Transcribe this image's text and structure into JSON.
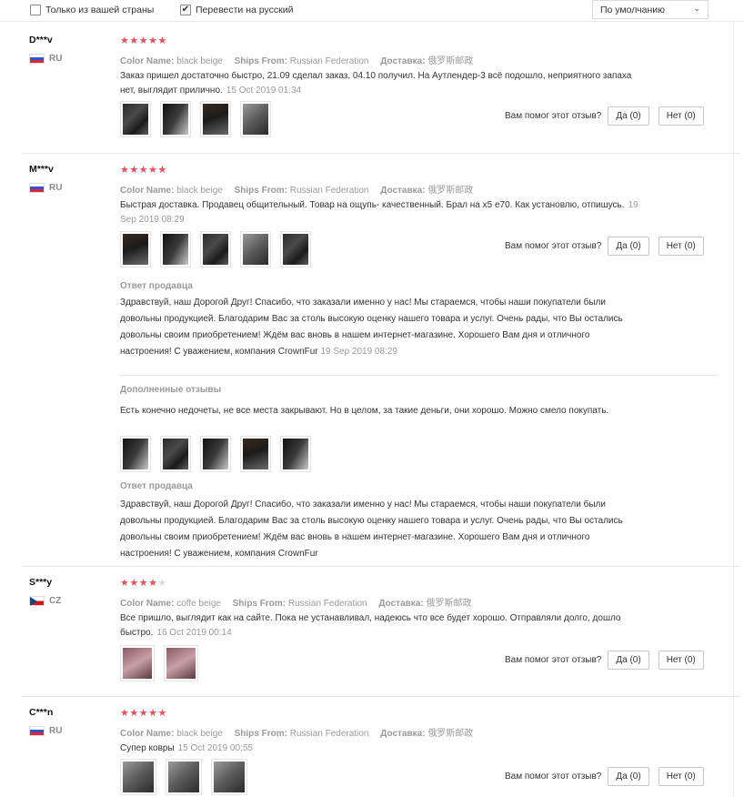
{
  "filters": {
    "only_country": {
      "label": "Только из вашей страны",
      "checked": false
    },
    "translate": {
      "label": "Перевести на русский",
      "checked": true
    },
    "sort": {
      "value": "По умолчанию"
    }
  },
  "labels": {
    "color_name": "Color Name:",
    "ships_from": "Ships From:",
    "delivery": "Доставка:",
    "helpful_q": "Вам помог этот отзыв?",
    "seller_reply": "Ответ продавца",
    "additional": "Дополненные отзывы"
  },
  "reviews": [
    {
      "user": "D***v",
      "country": "RU",
      "stars": 5,
      "color": "black beige",
      "ships_from": "Russian Federation",
      "delivery": "俄罗斯邮政",
      "text": "Заказ пришел достаточно быстро, 21.09 сделал заказ, 04.10 получил. На Аутлендер-3 всё подошло, неприятного запаха нет, выглядит прилично.",
      "date": "15 Oct 2019 01:34",
      "yes": "Да (0)",
      "no": "Нет (0)"
    },
    {
      "user": "M***v",
      "country": "RU",
      "stars": 5,
      "color": "black beige",
      "ships_from": "Russian Federation",
      "delivery": "俄罗斯邮政",
      "text": "Быстрая доставка. Продавец общительный. Товар на ощупь- качественный. Брал на x5 e70. Как установлю, отпишусь.",
      "date": "19 Sep 2019 08:29",
      "yes": "Да (0)",
      "no": "Нет (0)",
      "reply": "Здравствуй, наш Дорогой Друг! Спасибо, что заказали именно у нас! Мы стараемся, чтобы наши покупатели были довольны продукцией. Благодарим Вас за столь высокую оценку нашего товара и услуг. Очень рады, что Вы остались довольны своим приобретением! Ждём вас вновь в нашем интернет-магазине. Хорошего Вам дня и отличного настроения! С уважением, компания CrownFur",
      "reply_date": "19 Sep 2019 08:29",
      "additional": "Есть конечно недочеты, не все места закрывают. Но в целом, за такие деньги, они хорошо. Можно смело покупать.",
      "reply2": "Здравствуй, наш Дорогой Друг! Спасибо, что заказали именно у нас! Мы стараемся, чтобы наши покупатели были довольны продукцией. Благодарим Вас за столь высокую оценку нашего товара и услуг. Очень рады, что Вы остались довольны своим приобретением! Ждём вас вновь в нашем интернет-магазине. Хорошего Вам дня и отличного настроения! С уважением, компания CrownFur"
    },
    {
      "user": "S***y",
      "country": "CZ",
      "stars": 4,
      "color": "coffe beige",
      "ships_from": "Russian Federation",
      "delivery": "俄罗斯邮政",
      "text": "Все пришло, выглядит как на сайте. Пока не устанавливал, надеюсь что все будет хорошо. Отправляли долго, дошло быстро.",
      "date": "16 Oct 2019 00:14",
      "yes": "Да (0)",
      "no": "Нет (0)"
    },
    {
      "user": "C***n",
      "country": "RU",
      "stars": 5,
      "color": "black beige",
      "ships_from": "Russian Federation",
      "delivery": "俄罗斯邮政",
      "text": "Супер ковры",
      "date": "15 Oct 2019 00:55",
      "yes": "Да (0)",
      "no": "Нет (0)"
    }
  ],
  "icons": {
    "checkbox_checked": "checkmark-icon",
    "dropdown": "chevron-down-icon",
    "star": "star-icon"
  }
}
